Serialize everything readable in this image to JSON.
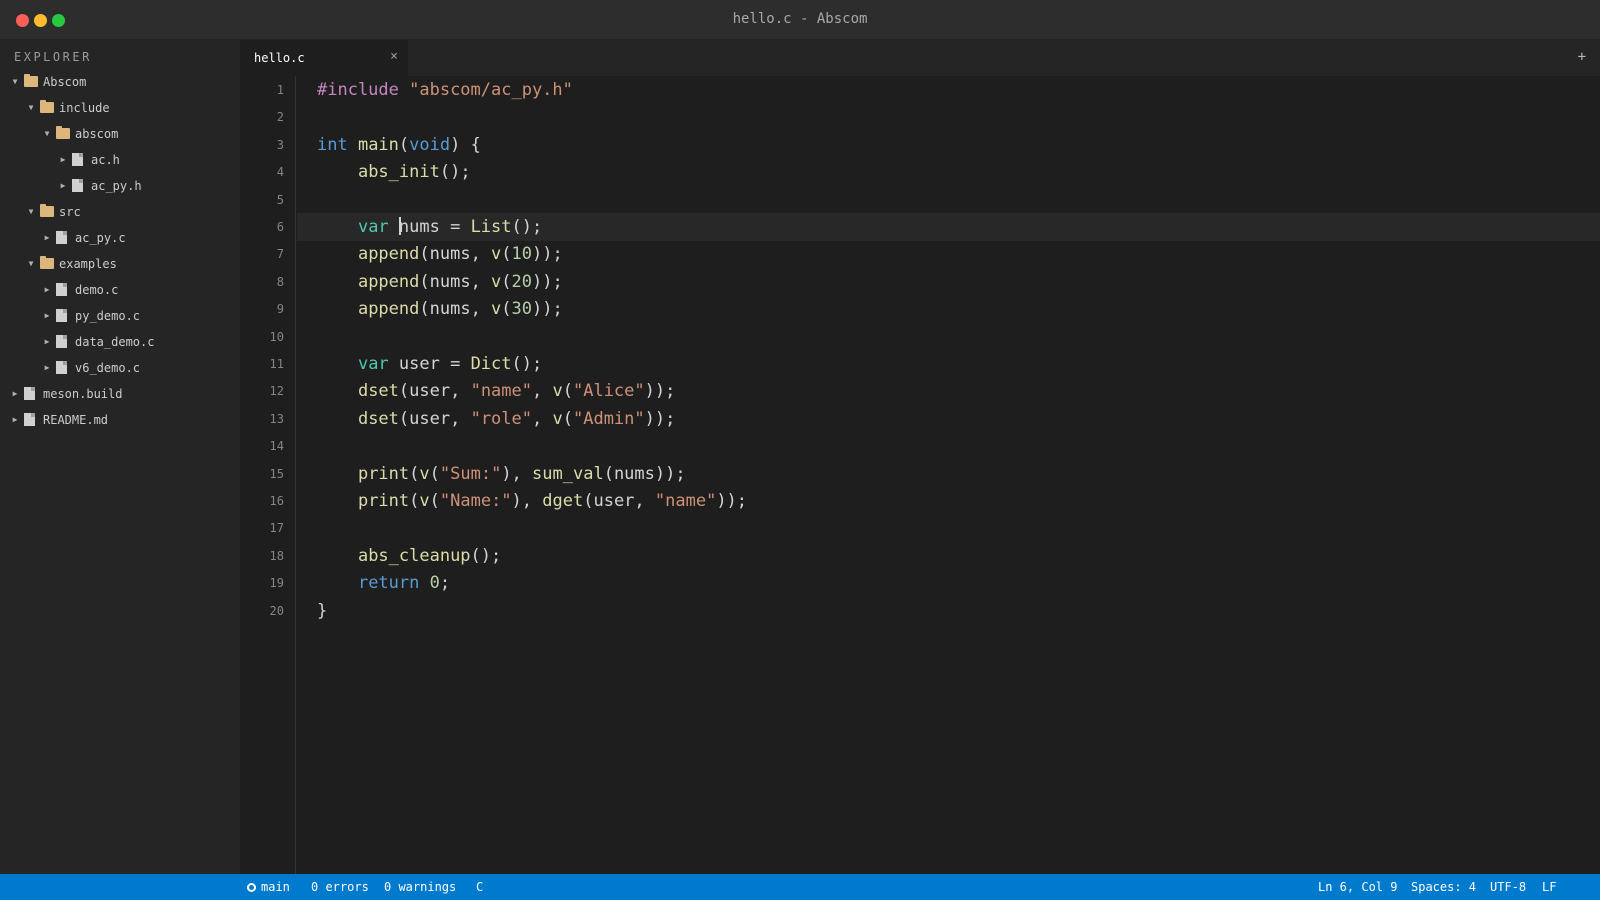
{
  "window": {
    "title": "hello.c - Abscom"
  },
  "sidebar": {
    "title": "EXPLORER",
    "items": [
      {
        "label": "Abscom",
        "type": "folder",
        "expanded": true,
        "depth": 0
      },
      {
        "label": "include",
        "type": "folder",
        "expanded": true,
        "depth": 1
      },
      {
        "label": "abscom",
        "type": "folder",
        "expanded": true,
        "depth": 2
      },
      {
        "label": "ac.h",
        "type": "file",
        "depth": 3
      },
      {
        "label": "ac_py.h",
        "type": "file",
        "depth": 3
      },
      {
        "label": "src",
        "type": "folder",
        "expanded": true,
        "depth": 1
      },
      {
        "label": "ac_py.c",
        "type": "file",
        "depth": 2
      },
      {
        "label": "examples",
        "type": "folder",
        "expanded": true,
        "depth": 1
      },
      {
        "label": "demo.c",
        "type": "file",
        "depth": 2
      },
      {
        "label": "py_demo.c",
        "type": "file",
        "depth": 2
      },
      {
        "label": "data_demo.c",
        "type": "file",
        "depth": 2
      },
      {
        "label": "v6_demo.c",
        "type": "file",
        "depth": 2
      },
      {
        "label": "meson.build",
        "type": "file",
        "depth": 0
      },
      {
        "label": "README.md",
        "type": "file",
        "depth": 0
      }
    ]
  },
  "tabs": [
    {
      "label": "hello.c",
      "close": "×",
      "active": true
    }
  ],
  "new_tab": "+",
  "editor": {
    "active_line": 6,
    "cursor_col": 9,
    "lines": [
      [
        [
          "pp",
          "#include "
        ],
        [
          "str",
          "\"abscom/ac_py.h\""
        ]
      ],
      [],
      [
        [
          "kw",
          "int "
        ],
        [
          "fn",
          "main"
        ],
        [
          "punc",
          "("
        ],
        [
          "kw",
          "void"
        ],
        [
          "punc",
          ") {"
        ]
      ],
      [
        [
          "var",
          "    "
        ],
        [
          "fn",
          "abs_init"
        ],
        [
          "punc",
          "();"
        ]
      ],
      [],
      [
        [
          "var",
          "    "
        ],
        [
          "type",
          "var "
        ],
        [
          "var",
          "nums = "
        ],
        [
          "fn",
          "List"
        ],
        [
          "punc",
          "();"
        ]
      ],
      [
        [
          "var",
          "    "
        ],
        [
          "fn",
          "append"
        ],
        [
          "punc",
          "("
        ],
        [
          "var",
          "nums, "
        ],
        [
          "fn",
          "v"
        ],
        [
          "punc",
          "("
        ],
        [
          "num",
          "10"
        ],
        [
          "punc",
          "));"
        ]
      ],
      [
        [
          "var",
          "    "
        ],
        [
          "fn",
          "append"
        ],
        [
          "punc",
          "("
        ],
        [
          "var",
          "nums, "
        ],
        [
          "fn",
          "v"
        ],
        [
          "punc",
          "("
        ],
        [
          "num",
          "20"
        ],
        [
          "punc",
          "));"
        ]
      ],
      [
        [
          "var",
          "    "
        ],
        [
          "fn",
          "append"
        ],
        [
          "punc",
          "("
        ],
        [
          "var",
          "nums, "
        ],
        [
          "fn",
          "v"
        ],
        [
          "punc",
          "("
        ],
        [
          "num",
          "30"
        ],
        [
          "punc",
          "));"
        ]
      ],
      [],
      [
        [
          "var",
          "    "
        ],
        [
          "type",
          "var "
        ],
        [
          "var",
          "user = "
        ],
        [
          "fn",
          "Dict"
        ],
        [
          "punc",
          "();"
        ]
      ],
      [
        [
          "var",
          "    "
        ],
        [
          "fn",
          "dset"
        ],
        [
          "punc",
          "("
        ],
        [
          "var",
          "user, "
        ],
        [
          "str",
          "\"name\""
        ],
        [
          "punc",
          ", "
        ],
        [
          "fn",
          "v"
        ],
        [
          "punc",
          "("
        ],
        [
          "str",
          "\"Alice\""
        ],
        [
          "punc",
          "));"
        ]
      ],
      [
        [
          "var",
          "    "
        ],
        [
          "fn",
          "dset"
        ],
        [
          "punc",
          "("
        ],
        [
          "var",
          "user, "
        ],
        [
          "str",
          "\"role\""
        ],
        [
          "punc",
          ", "
        ],
        [
          "fn",
          "v"
        ],
        [
          "punc",
          "("
        ],
        [
          "str",
          "\"Admin\""
        ],
        [
          "punc",
          "));"
        ]
      ],
      [],
      [
        [
          "var",
          "    "
        ],
        [
          "fn",
          "print"
        ],
        [
          "punc",
          "("
        ],
        [
          "fn",
          "v"
        ],
        [
          "punc",
          "("
        ],
        [
          "str",
          "\"Sum:\""
        ],
        [
          "punc",
          "), "
        ],
        [
          "fn",
          "sum_val"
        ],
        [
          "punc",
          "("
        ],
        [
          "var",
          "nums"
        ],
        [
          "punc",
          "));"
        ]
      ],
      [
        [
          "var",
          "    "
        ],
        [
          "fn",
          "print"
        ],
        [
          "punc",
          "("
        ],
        [
          "fn",
          "v"
        ],
        [
          "punc",
          "("
        ],
        [
          "str",
          "\"Name:\""
        ],
        [
          "punc",
          "), "
        ],
        [
          "fn",
          "dget"
        ],
        [
          "punc",
          "("
        ],
        [
          "var",
          "user, "
        ],
        [
          "str",
          "\"name\""
        ],
        [
          "punc",
          "));"
        ]
      ],
      [],
      [
        [
          "var",
          "    "
        ],
        [
          "fn",
          "abs_cleanup"
        ],
        [
          "punc",
          "();"
        ]
      ],
      [
        [
          "var",
          "    "
        ],
        [
          "kw",
          "return "
        ],
        [
          "num",
          "0"
        ],
        [
          "punc",
          ";"
        ]
      ],
      [
        [
          "punc",
          "}"
        ]
      ]
    ]
  },
  "statusbar": {
    "branch": "main",
    "errors": "0 errors",
    "warnings": "0 warnings",
    "language": "C",
    "position": "Ln 6, Col 9",
    "spaces": "Spaces: 4",
    "encoding": "UTF-8",
    "eol": "LF"
  },
  "colors": {
    "accent": "#007acc",
    "preprocessor": "#c586c0",
    "string": "#ce9178",
    "keyword": "#569cd6",
    "function": "#dcdcaa",
    "number": "#b5cea8",
    "type": "#4ec9b0",
    "folder": "#dcb67a"
  },
  "icons": {
    "traffic_lights": [
      "close-icon",
      "minimize-icon",
      "maximize-icon"
    ],
    "folder": "folder-icon",
    "file": "file-icon",
    "branch": "git-branch-icon"
  }
}
